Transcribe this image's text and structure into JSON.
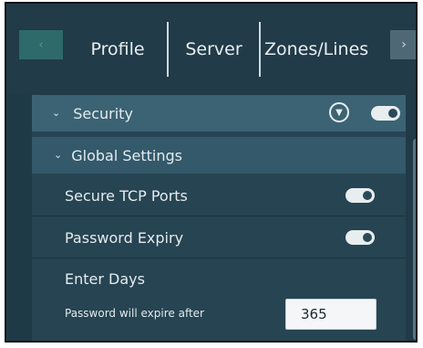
{
  "tabs": {
    "scroll_left_icon": "chevron-left-icon",
    "scroll_left_glyph": "‹",
    "items": [
      {
        "label": "Profile"
      },
      {
        "label": "Server"
      },
      {
        "label": "Zones/Lines"
      }
    ],
    "active": "Server",
    "scroll_right_glyph": "›"
  },
  "security": {
    "header": "Security",
    "chevron": "⌄",
    "filter_glyph": "▼",
    "enabled": true
  },
  "global_settings": {
    "header": "Global Settings",
    "chevron": "⌄"
  },
  "settings": {
    "secure_tcp": {
      "label": "Secure TCP Ports",
      "enabled": true
    },
    "password_expiry": {
      "label": "Password Expiry",
      "enabled": true
    }
  },
  "expiry_days": {
    "title": "Enter Days",
    "label": "Password will expire after",
    "value": "365"
  },
  "colors": {
    "background": "#1f3a47",
    "accent_row": "#3b6373",
    "toggle_on": "#e8edf0"
  }
}
